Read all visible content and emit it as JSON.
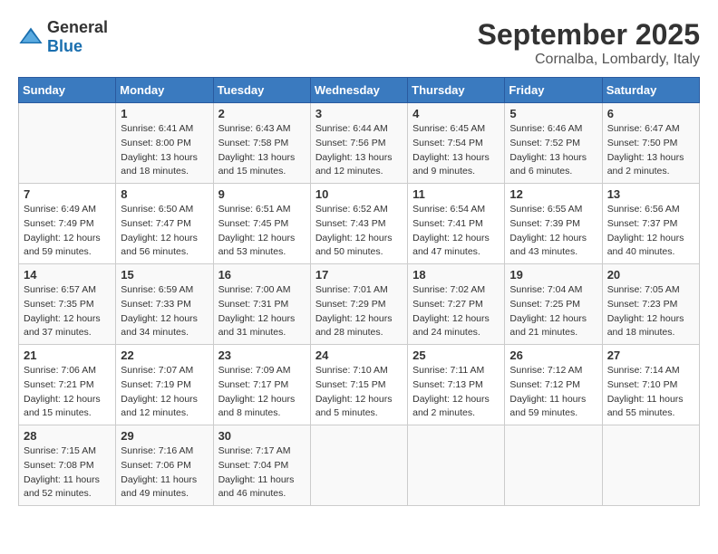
{
  "header": {
    "logo_general": "General",
    "logo_blue": "Blue",
    "month": "September 2025",
    "location": "Cornalba, Lombardy, Italy"
  },
  "weekdays": [
    "Sunday",
    "Monday",
    "Tuesday",
    "Wednesday",
    "Thursday",
    "Friday",
    "Saturday"
  ],
  "weeks": [
    [
      {
        "day": "",
        "sunrise": "",
        "sunset": "",
        "daylight": ""
      },
      {
        "day": "1",
        "sunrise": "Sunrise: 6:41 AM",
        "sunset": "Sunset: 8:00 PM",
        "daylight": "Daylight: 13 hours and 18 minutes."
      },
      {
        "day": "2",
        "sunrise": "Sunrise: 6:43 AM",
        "sunset": "Sunset: 7:58 PM",
        "daylight": "Daylight: 13 hours and 15 minutes."
      },
      {
        "day": "3",
        "sunrise": "Sunrise: 6:44 AM",
        "sunset": "Sunset: 7:56 PM",
        "daylight": "Daylight: 13 hours and 12 minutes."
      },
      {
        "day": "4",
        "sunrise": "Sunrise: 6:45 AM",
        "sunset": "Sunset: 7:54 PM",
        "daylight": "Daylight: 13 hours and 9 minutes."
      },
      {
        "day": "5",
        "sunrise": "Sunrise: 6:46 AM",
        "sunset": "Sunset: 7:52 PM",
        "daylight": "Daylight: 13 hours and 6 minutes."
      },
      {
        "day": "6",
        "sunrise": "Sunrise: 6:47 AM",
        "sunset": "Sunset: 7:50 PM",
        "daylight": "Daylight: 13 hours and 2 minutes."
      }
    ],
    [
      {
        "day": "7",
        "sunrise": "Sunrise: 6:49 AM",
        "sunset": "Sunset: 7:49 PM",
        "daylight": "Daylight: 12 hours and 59 minutes."
      },
      {
        "day": "8",
        "sunrise": "Sunrise: 6:50 AM",
        "sunset": "Sunset: 7:47 PM",
        "daylight": "Daylight: 12 hours and 56 minutes."
      },
      {
        "day": "9",
        "sunrise": "Sunrise: 6:51 AM",
        "sunset": "Sunset: 7:45 PM",
        "daylight": "Daylight: 12 hours and 53 minutes."
      },
      {
        "day": "10",
        "sunrise": "Sunrise: 6:52 AM",
        "sunset": "Sunset: 7:43 PM",
        "daylight": "Daylight: 12 hours and 50 minutes."
      },
      {
        "day": "11",
        "sunrise": "Sunrise: 6:54 AM",
        "sunset": "Sunset: 7:41 PM",
        "daylight": "Daylight: 12 hours and 47 minutes."
      },
      {
        "day": "12",
        "sunrise": "Sunrise: 6:55 AM",
        "sunset": "Sunset: 7:39 PM",
        "daylight": "Daylight: 12 hours and 43 minutes."
      },
      {
        "day": "13",
        "sunrise": "Sunrise: 6:56 AM",
        "sunset": "Sunset: 7:37 PM",
        "daylight": "Daylight: 12 hours and 40 minutes."
      }
    ],
    [
      {
        "day": "14",
        "sunrise": "Sunrise: 6:57 AM",
        "sunset": "Sunset: 7:35 PM",
        "daylight": "Daylight: 12 hours and 37 minutes."
      },
      {
        "day": "15",
        "sunrise": "Sunrise: 6:59 AM",
        "sunset": "Sunset: 7:33 PM",
        "daylight": "Daylight: 12 hours and 34 minutes."
      },
      {
        "day": "16",
        "sunrise": "Sunrise: 7:00 AM",
        "sunset": "Sunset: 7:31 PM",
        "daylight": "Daylight: 12 hours and 31 minutes."
      },
      {
        "day": "17",
        "sunrise": "Sunrise: 7:01 AM",
        "sunset": "Sunset: 7:29 PM",
        "daylight": "Daylight: 12 hours and 28 minutes."
      },
      {
        "day": "18",
        "sunrise": "Sunrise: 7:02 AM",
        "sunset": "Sunset: 7:27 PM",
        "daylight": "Daylight: 12 hours and 24 minutes."
      },
      {
        "day": "19",
        "sunrise": "Sunrise: 7:04 AM",
        "sunset": "Sunset: 7:25 PM",
        "daylight": "Daylight: 12 hours and 21 minutes."
      },
      {
        "day": "20",
        "sunrise": "Sunrise: 7:05 AM",
        "sunset": "Sunset: 7:23 PM",
        "daylight": "Daylight: 12 hours and 18 minutes."
      }
    ],
    [
      {
        "day": "21",
        "sunrise": "Sunrise: 7:06 AM",
        "sunset": "Sunset: 7:21 PM",
        "daylight": "Daylight: 12 hours and 15 minutes."
      },
      {
        "day": "22",
        "sunrise": "Sunrise: 7:07 AM",
        "sunset": "Sunset: 7:19 PM",
        "daylight": "Daylight: 12 hours and 12 minutes."
      },
      {
        "day": "23",
        "sunrise": "Sunrise: 7:09 AM",
        "sunset": "Sunset: 7:17 PM",
        "daylight": "Daylight: 12 hours and 8 minutes."
      },
      {
        "day": "24",
        "sunrise": "Sunrise: 7:10 AM",
        "sunset": "Sunset: 7:15 PM",
        "daylight": "Daylight: 12 hours and 5 minutes."
      },
      {
        "day": "25",
        "sunrise": "Sunrise: 7:11 AM",
        "sunset": "Sunset: 7:13 PM",
        "daylight": "Daylight: 12 hours and 2 minutes."
      },
      {
        "day": "26",
        "sunrise": "Sunrise: 7:12 AM",
        "sunset": "Sunset: 7:12 PM",
        "daylight": "Daylight: 11 hours and 59 minutes."
      },
      {
        "day": "27",
        "sunrise": "Sunrise: 7:14 AM",
        "sunset": "Sunset: 7:10 PM",
        "daylight": "Daylight: 11 hours and 55 minutes."
      }
    ],
    [
      {
        "day": "28",
        "sunrise": "Sunrise: 7:15 AM",
        "sunset": "Sunset: 7:08 PM",
        "daylight": "Daylight: 11 hours and 52 minutes."
      },
      {
        "day": "29",
        "sunrise": "Sunrise: 7:16 AM",
        "sunset": "Sunset: 7:06 PM",
        "daylight": "Daylight: 11 hours and 49 minutes."
      },
      {
        "day": "30",
        "sunrise": "Sunrise: 7:17 AM",
        "sunset": "Sunset: 7:04 PM",
        "daylight": "Daylight: 11 hours and 46 minutes."
      },
      {
        "day": "",
        "sunrise": "",
        "sunset": "",
        "daylight": ""
      },
      {
        "day": "",
        "sunrise": "",
        "sunset": "",
        "daylight": ""
      },
      {
        "day": "",
        "sunrise": "",
        "sunset": "",
        "daylight": ""
      },
      {
        "day": "",
        "sunrise": "",
        "sunset": "",
        "daylight": ""
      }
    ]
  ]
}
